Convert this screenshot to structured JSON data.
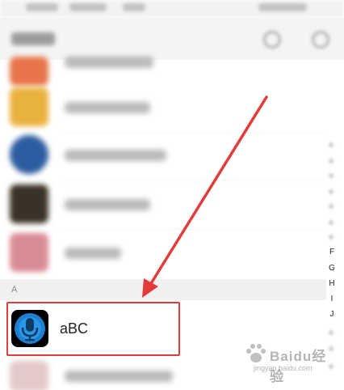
{
  "section": {
    "label": "A"
  },
  "highlighted_app": {
    "label": "aBC",
    "icon": "microphone-icon"
  },
  "alphabet_index": [
    "F",
    "G",
    "H",
    "I",
    "J"
  ],
  "annotation": {
    "color": "#e23c3c"
  },
  "watermark": {
    "text": "Baidu经验",
    "sub": "jingyan.baidu.com"
  }
}
